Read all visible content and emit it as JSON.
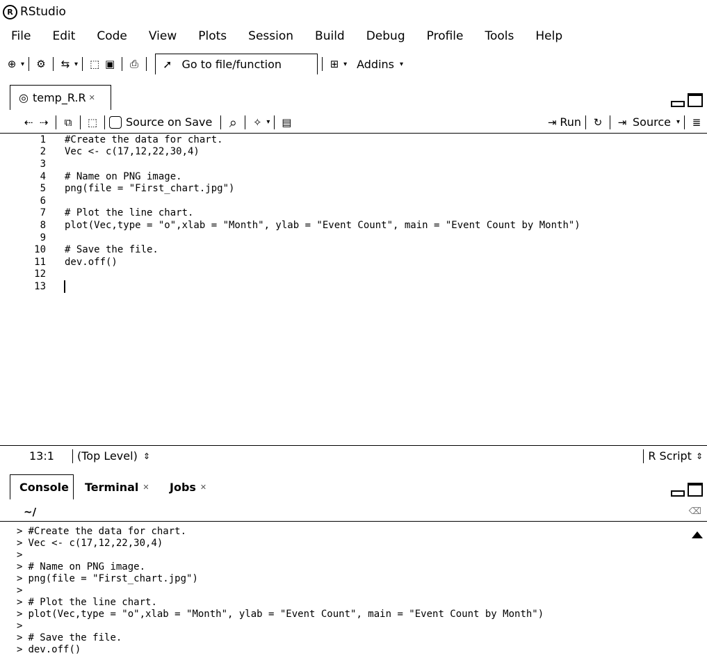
{
  "window": {
    "title": "RStudio"
  },
  "menu": [
    "File",
    "Edit",
    "Code",
    "View",
    "Plots",
    "Session",
    "Build",
    "Debug",
    "Profile",
    "Tools",
    "Help"
  ],
  "main_toolbar": {
    "goto_label": "Go to file/function",
    "addins_label": "Addins"
  },
  "editor": {
    "tab_label": "temp_R.R",
    "source_on_save_label": "Source on Save",
    "run_label": "Run",
    "source_label": "Source",
    "lines": [
      {
        "n": "1",
        "text": "#Create the data for chart."
      },
      {
        "n": "2",
        "text": "Vec <- c(17,12,22,30,4)"
      },
      {
        "n": "3",
        "text": ""
      },
      {
        "n": "4",
        "text": "# Name on PNG image."
      },
      {
        "n": "5",
        "text": "png(file = \"First_chart.jpg\")"
      },
      {
        "n": "6",
        "text": ""
      },
      {
        "n": "7",
        "text": "# Plot the line chart."
      },
      {
        "n": "8",
        "text": "plot(Vec,type = \"o\",xlab = \"Month\", ylab = \"Event Count\", main = \"Event Count by Month\")"
      },
      {
        "n": "9",
        "text": ""
      },
      {
        "n": "10",
        "text": "# Save the file."
      },
      {
        "n": "11",
        "text": "dev.off()"
      },
      {
        "n": "12",
        "text": ""
      },
      {
        "n": "13",
        "text": ""
      }
    ]
  },
  "status": {
    "position": "13:1",
    "scope": "(Top Level)",
    "filetype": "R Script"
  },
  "console": {
    "tabs": [
      "Console",
      "Terminal",
      "Jobs"
    ],
    "path": "~/",
    "prompt": ">",
    "lines": [
      "#Create the data for chart.",
      "Vec <- c(17,12,22,30,4)",
      "",
      "# Name on PNG image.",
      "png(file = \"First_chart.jpg\")",
      "",
      "# Plot the line chart.",
      "plot(Vec,type = \"o\",xlab = \"Month\", ylab = \"Event Count\", main = \"Event Count by Month\")",
      "",
      "# Save the file.",
      "dev.off()"
    ]
  }
}
